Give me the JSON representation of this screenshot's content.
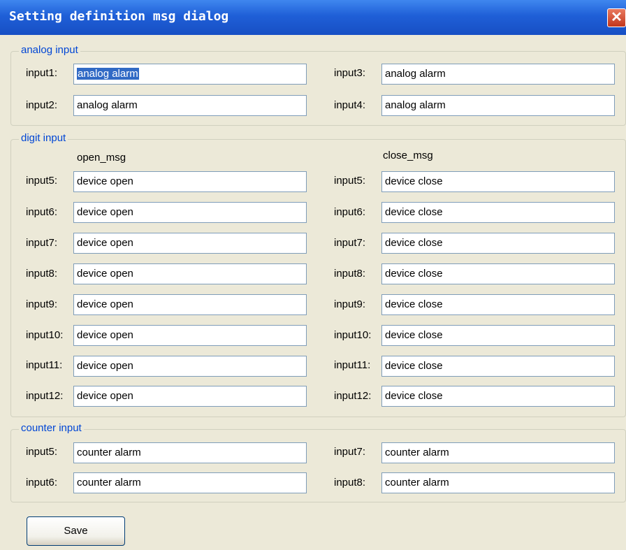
{
  "window": {
    "title": "Setting definition msg dialog",
    "close_icon": "close-x-icon"
  },
  "analog": {
    "legend": "analog input",
    "rows": [
      {
        "label": "input1:",
        "value": "analog alarm"
      },
      {
        "label": "input2:",
        "value": "analog alarm"
      },
      {
        "label": "input3:",
        "value": "analog alarm"
      },
      {
        "label": "input4:",
        "value": "analog alarm"
      }
    ]
  },
  "digit": {
    "legend": "digit input",
    "open_header": "open_msg",
    "close_header": "close_msg",
    "open_rows": [
      {
        "label": "input5:",
        "value": "device open"
      },
      {
        "label": "input6:",
        "value": "device open"
      },
      {
        "label": "input7:",
        "value": "device open"
      },
      {
        "label": "input8:",
        "value": "device open"
      },
      {
        "label": "input9:",
        "value": "device open"
      },
      {
        "label": "input10:",
        "value": "device open"
      },
      {
        "label": "input11:",
        "value": "device open"
      },
      {
        "label": "input12:",
        "value": "device open"
      }
    ],
    "close_rows": [
      {
        "label": "input5:",
        "value": "device close"
      },
      {
        "label": "input6:",
        "value": "device close"
      },
      {
        "label": "input7:",
        "value": "device close"
      },
      {
        "label": "input8:",
        "value": "device close"
      },
      {
        "label": "input9:",
        "value": "device close"
      },
      {
        "label": "input10:",
        "value": "device close"
      },
      {
        "label": "input11:",
        "value": "device close"
      },
      {
        "label": "input12:",
        "value": "device close"
      }
    ]
  },
  "counter": {
    "legend": "counter input",
    "rows": [
      {
        "label": "input5:",
        "value": "counter alarm"
      },
      {
        "label": "input6:",
        "value": "counter alarm"
      },
      {
        "label": "input7:",
        "value": "counter alarm"
      },
      {
        "label": "input8:",
        "value": "counter alarm"
      }
    ]
  },
  "save_label": "Save"
}
